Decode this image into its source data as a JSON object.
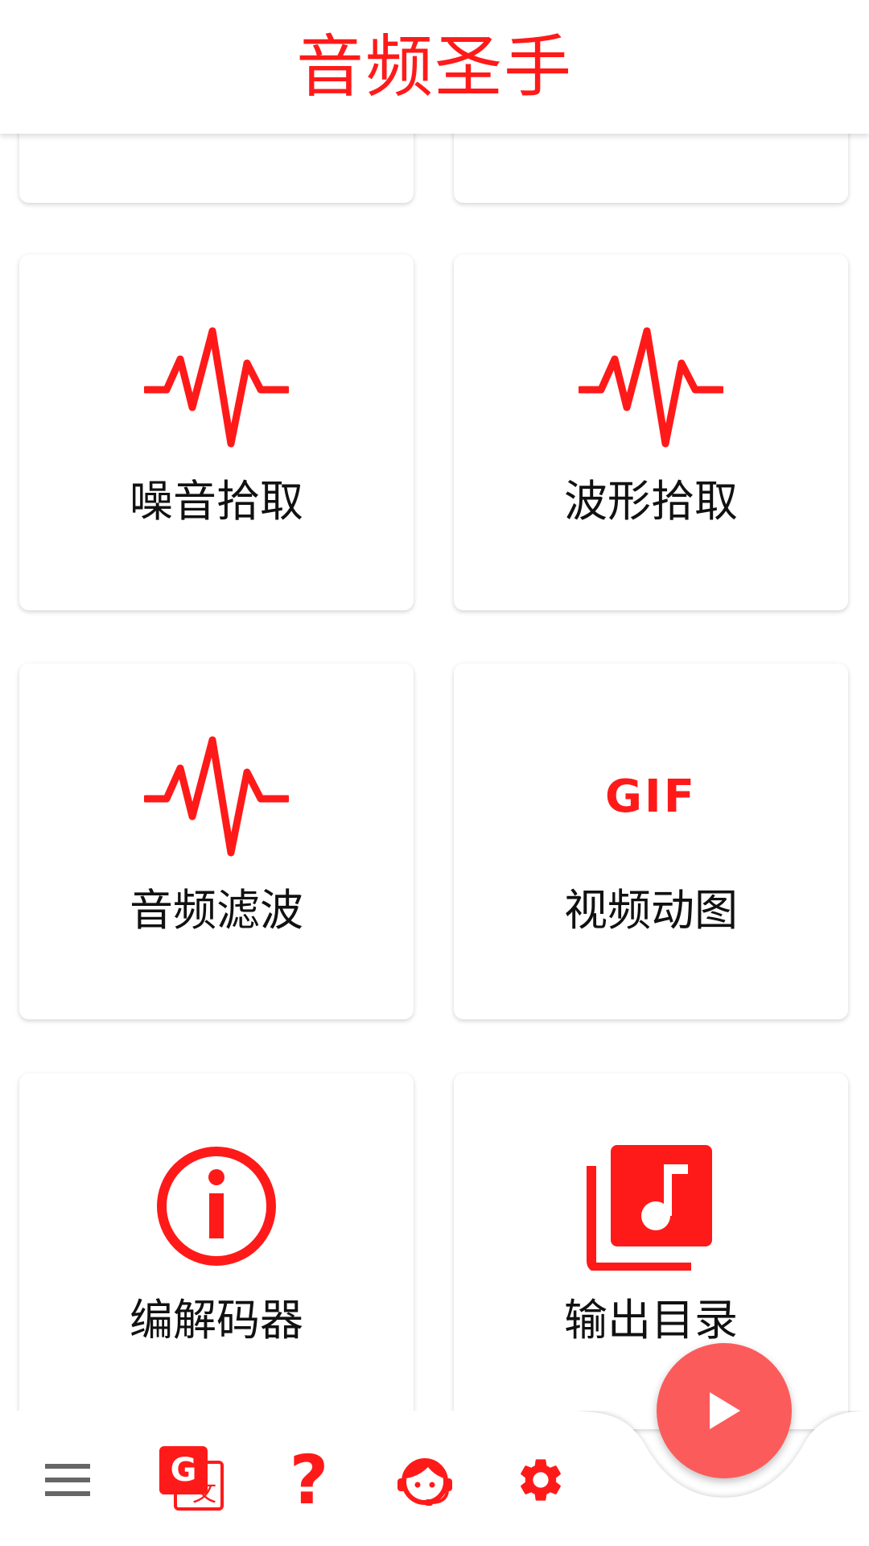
{
  "header": {
    "title": "音频圣手"
  },
  "grid": {
    "cards": [
      {
        "label": "",
        "icon": "blank"
      },
      {
        "label": "",
        "icon": "blank"
      },
      {
        "label": "噪音拾取",
        "icon": "waveform-icon"
      },
      {
        "label": "波形拾取",
        "icon": "waveform-icon"
      },
      {
        "label": "音频滤波",
        "icon": "waveform-icon"
      },
      {
        "label": "视频动图",
        "icon": "gif-icon"
      },
      {
        "label": "编解码器",
        "icon": "info-icon"
      },
      {
        "label": "输出目录",
        "icon": "music-library-icon"
      }
    ]
  },
  "icons": {
    "gif_text": "GIF",
    "translate_letter": "G",
    "translate_glyph": "文",
    "help_glyph": "?"
  },
  "bottom_nav": {
    "items": [
      {
        "icon": "menu-icon"
      },
      {
        "icon": "translate-icon"
      },
      {
        "icon": "help-icon"
      },
      {
        "icon": "support-agent-icon"
      },
      {
        "icon": "settings-icon"
      }
    ],
    "fab": {
      "icon": "play-icon"
    }
  },
  "colors": {
    "accent": "#ff1a1a",
    "fab": "#fc5b5b",
    "text": "#111111",
    "nav_gray": "#666666"
  }
}
